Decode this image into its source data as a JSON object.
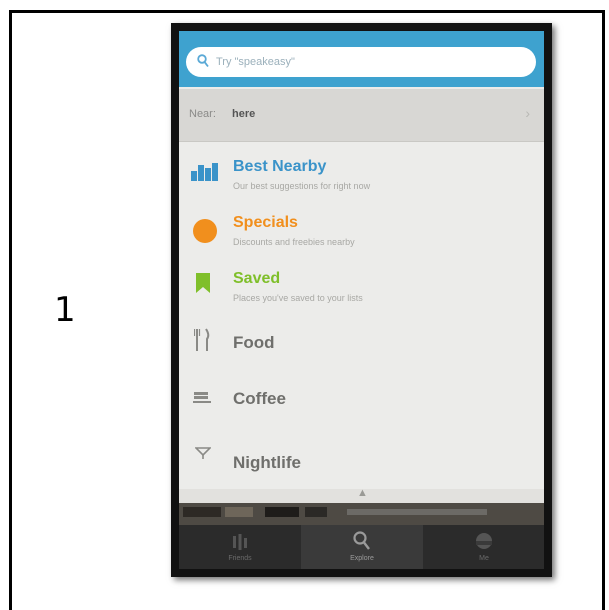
{
  "slide_number": "1",
  "search": {
    "placeholder": "Try \"speakeasy\""
  },
  "near": {
    "prefix": "Near:",
    "value": "here",
    "chevron": "›"
  },
  "featured": [
    {
      "title": "Best Nearby",
      "subtitle": "Our best suggestions for right now",
      "color": "#3a93c9",
      "icon": "bar-chart-icon"
    },
    {
      "title": "Specials",
      "subtitle": "Discounts and freebies nearby",
      "color": "#f18f1d",
      "icon": "circle-icon"
    },
    {
      "title": "Saved",
      "subtitle": "Places you've saved to your lists",
      "color": "#7fbf2a",
      "icon": "bookmark-icon"
    }
  ],
  "categories": [
    {
      "title": "Food",
      "icon": "fork-knife-icon"
    },
    {
      "title": "Coffee",
      "icon": "coffee-cup-icon"
    },
    {
      "title": "Nightlife",
      "icon": "cocktail-glass-icon"
    }
  ],
  "tabs": [
    {
      "label": "Friends",
      "icon": "friends-icon"
    },
    {
      "label": "Explore",
      "icon": "search-icon"
    },
    {
      "label": "Me",
      "icon": "person-icon"
    }
  ],
  "colors": {
    "accent": "#3ea2cf",
    "tabbar": "#2b2b2b"
  }
}
